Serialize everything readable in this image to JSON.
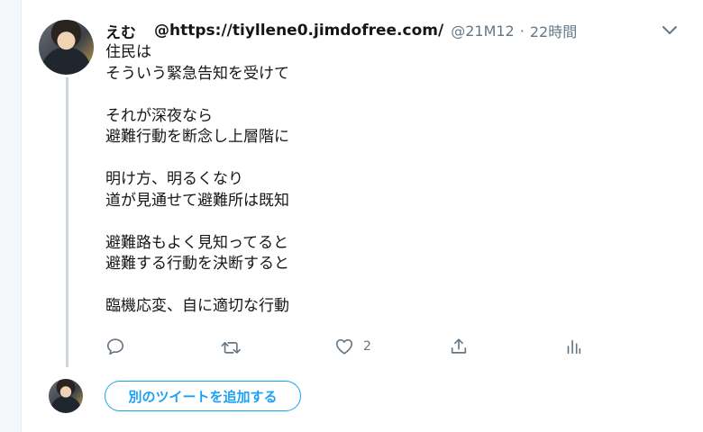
{
  "tweet": {
    "display_name": "えむ",
    "handle_text": "@https://tiyllene0.jimdofree.com/",
    "screen_name": "@21M12",
    "separator": "·",
    "time": "22時間",
    "lines": [
      "住民は",
      "そういう緊急告知を受けて",
      "",
      "それが深夜なら",
      "避難行動を断念し上層階に",
      "",
      "明け方、明るくなり",
      "道が見通せて避難所は既知",
      "",
      "避難路もよく見知ってると",
      "避難する行動を決断すると",
      "",
      "臨機応変、自に適切な行動"
    ],
    "actions": {
      "reply_icon": "reply-icon",
      "retweet_icon": "retweet-icon",
      "like_icon": "heart-icon",
      "like_count": "2",
      "share_icon": "share-icon",
      "analytics_icon": "analytics-icon"
    }
  },
  "composer": {
    "add_tweet_label": "別のツイートを追加する"
  },
  "colors": {
    "accent": "#1da1f2",
    "secondary_text": "#657786",
    "thread_line": "#ccd6dd"
  }
}
